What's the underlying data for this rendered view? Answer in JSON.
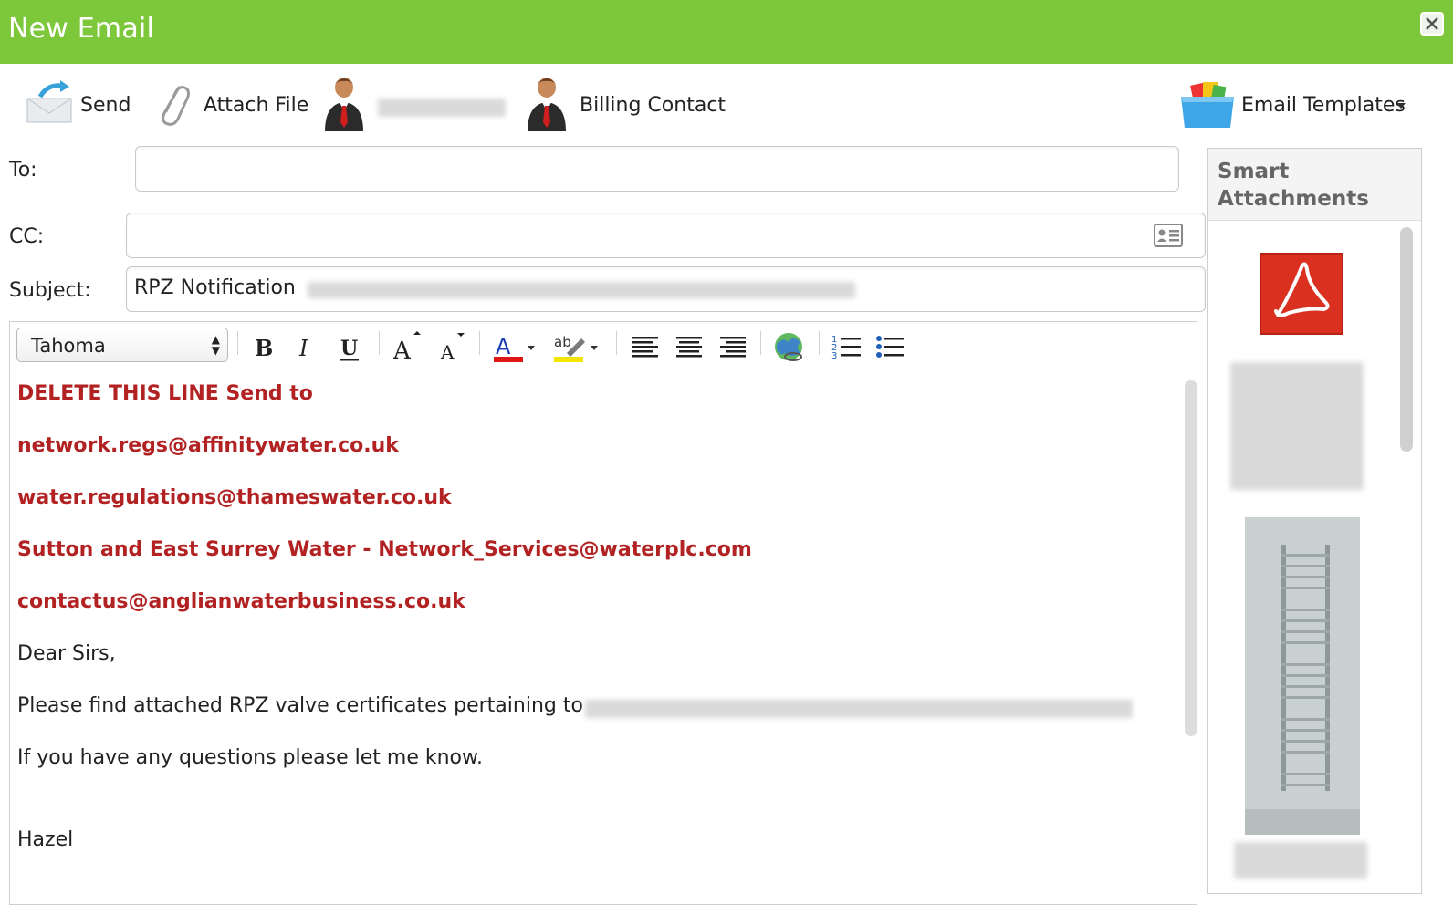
{
  "window": {
    "title": "New Email"
  },
  "toolbar": {
    "send_label": "Send",
    "attach_label": "Attach File",
    "billing_label": "Billing Contact",
    "templates_label": "Email Templates"
  },
  "fields": {
    "to_label": "To:",
    "to_value": "",
    "cc_label": "CC:",
    "cc_value": "",
    "subject_label": "Subject:",
    "subject_value": "RPZ Notification"
  },
  "editor": {
    "font": "Tahoma",
    "lines": [
      "DELETE THIS LINE Send to",
      "network.regs@affinitywater.co.uk",
      "water.regulations@thameswater.co.uk",
      "Sutton and East Surrey Water - Network_Services@waterplc.com",
      "contactus@anglianwaterbusiness.co.uk",
      "Dear Sirs,",
      "Please find attached RPZ valve certificates pertaining to",
      "If you have any questions please let me know.",
      "Hazel"
    ]
  },
  "side": {
    "title": "Smart Attachments"
  },
  "colors": {
    "titlebar": "#7dc73a",
    "highlight_text": "#b22222",
    "pdf_red": "#d9301f"
  }
}
